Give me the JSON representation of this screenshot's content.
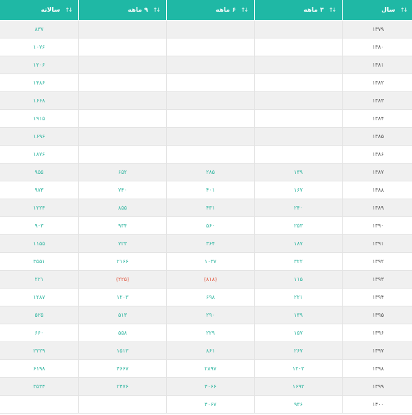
{
  "columns": {
    "year": "سال",
    "q3": "۳ ماهه",
    "q6": "۶ ماهه",
    "q9": "۹ ماهه",
    "annual": "سالانه"
  },
  "sort_glyph": "↓↑",
  "rows": [
    {
      "year": "۱۳۷۹",
      "q3": "",
      "q6": "",
      "q9": "",
      "annual": "۸۳۷"
    },
    {
      "year": "۱۳۸۰",
      "q3": "",
      "q6": "",
      "q9": "",
      "annual": "۱۰۷۶"
    },
    {
      "year": "۱۳۸۱",
      "q3": "",
      "q6": "",
      "q9": "",
      "annual": "۱۲۰۶"
    },
    {
      "year": "۱۳۸۲",
      "q3": "",
      "q6": "",
      "q9": "",
      "annual": "۱۴۸۶"
    },
    {
      "year": "۱۳۸۳",
      "q3": "",
      "q6": "",
      "q9": "",
      "annual": "۱۶۶۸"
    },
    {
      "year": "۱۳۸۴",
      "q3": "",
      "q6": "",
      "q9": "",
      "annual": "۱۹۱۵"
    },
    {
      "year": "۱۳۸۵",
      "q3": "",
      "q6": "",
      "q9": "",
      "annual": "۱۶۹۶"
    },
    {
      "year": "۱۳۸۶",
      "q3": "",
      "q6": "",
      "q9": "",
      "annual": "۱۸۷۶"
    },
    {
      "year": "۱۳۸۷",
      "q3": "۱۳۹",
      "q6": "۲۸۵",
      "q9": "۶۵۲",
      "annual": "۹۵۵"
    },
    {
      "year": "۱۳۸۸",
      "q3": "۱۶۷",
      "q6": "۴۰۱",
      "q9": "۷۴۰",
      "annual": "۹۷۳"
    },
    {
      "year": "۱۳۸۹",
      "q3": "۲۴۰",
      "q6": "۴۳۱",
      "q9": "۸۵۵",
      "annual": "۱۲۲۴"
    },
    {
      "year": "۱۳۹۰",
      "q3": "۲۵۳",
      "q6": "۵۶۰",
      "q9": "۹۳۴",
      "annual": "۹۰۳"
    },
    {
      "year": "۱۳۹۱",
      "q3": "۱۸۷",
      "q6": "۳۶۴",
      "q9": "۷۲۳",
      "annual": "۱۱۵۵"
    },
    {
      "year": "۱۳۹۲",
      "q3": "۳۲۲",
      "q6": "۱۰۳۷",
      "q9": "۲۱۶۶",
      "annual": "۳۵۵۱"
    },
    {
      "year": "۱۳۹۳",
      "q3": "۱۱۵",
      "q6": "(۸۱۸)",
      "q9": "(۲۲۵)",
      "annual": "۲۲۱",
      "q6_negative": true,
      "q9_negative": true
    },
    {
      "year": "۱۳۹۴",
      "q3": "۲۲۱",
      "q6": "۶۹۸",
      "q9": "۱۲۰۳",
      "annual": "۱۲۸۷"
    },
    {
      "year": "۱۳۹۵",
      "q3": "۱۳۹",
      "q6": "۲۹۰",
      "q9": "۵۱۳",
      "annual": "۵۲۵"
    },
    {
      "year": "۱۳۹۶",
      "q3": "۱۵۷",
      "q6": "۲۲۹",
      "q9": "۵۵۸",
      "annual": "۶۶۰"
    },
    {
      "year": "۱۳۹۷",
      "q3": "۲۶۷",
      "q6": "۸۶۱",
      "q9": "۱۵۱۳",
      "annual": "۲۲۲۹"
    },
    {
      "year": "۱۳۹۸",
      "q3": "۱۲۰۳",
      "q6": "۲۸۹۷",
      "q9": "۴۶۶۷",
      "annual": "۶۱۹۸"
    },
    {
      "year": "۱۳۹۹",
      "q3": "۱۶۹۳",
      "q6": "۴۰۶۶",
      "q9": "۲۴۷۶",
      "annual": "۳۵۳۴"
    },
    {
      "year": "۱۴۰۰",
      "q3": "۹۳۶",
      "q6": "۴۰۶۷",
      "q9": "",
      "annual": ""
    }
  ],
  "colors": {
    "header_bg": "#1fb8a5",
    "value": "#2fb5a0",
    "negative": "#e0533a",
    "stripe": "#f0f0f0"
  }
}
